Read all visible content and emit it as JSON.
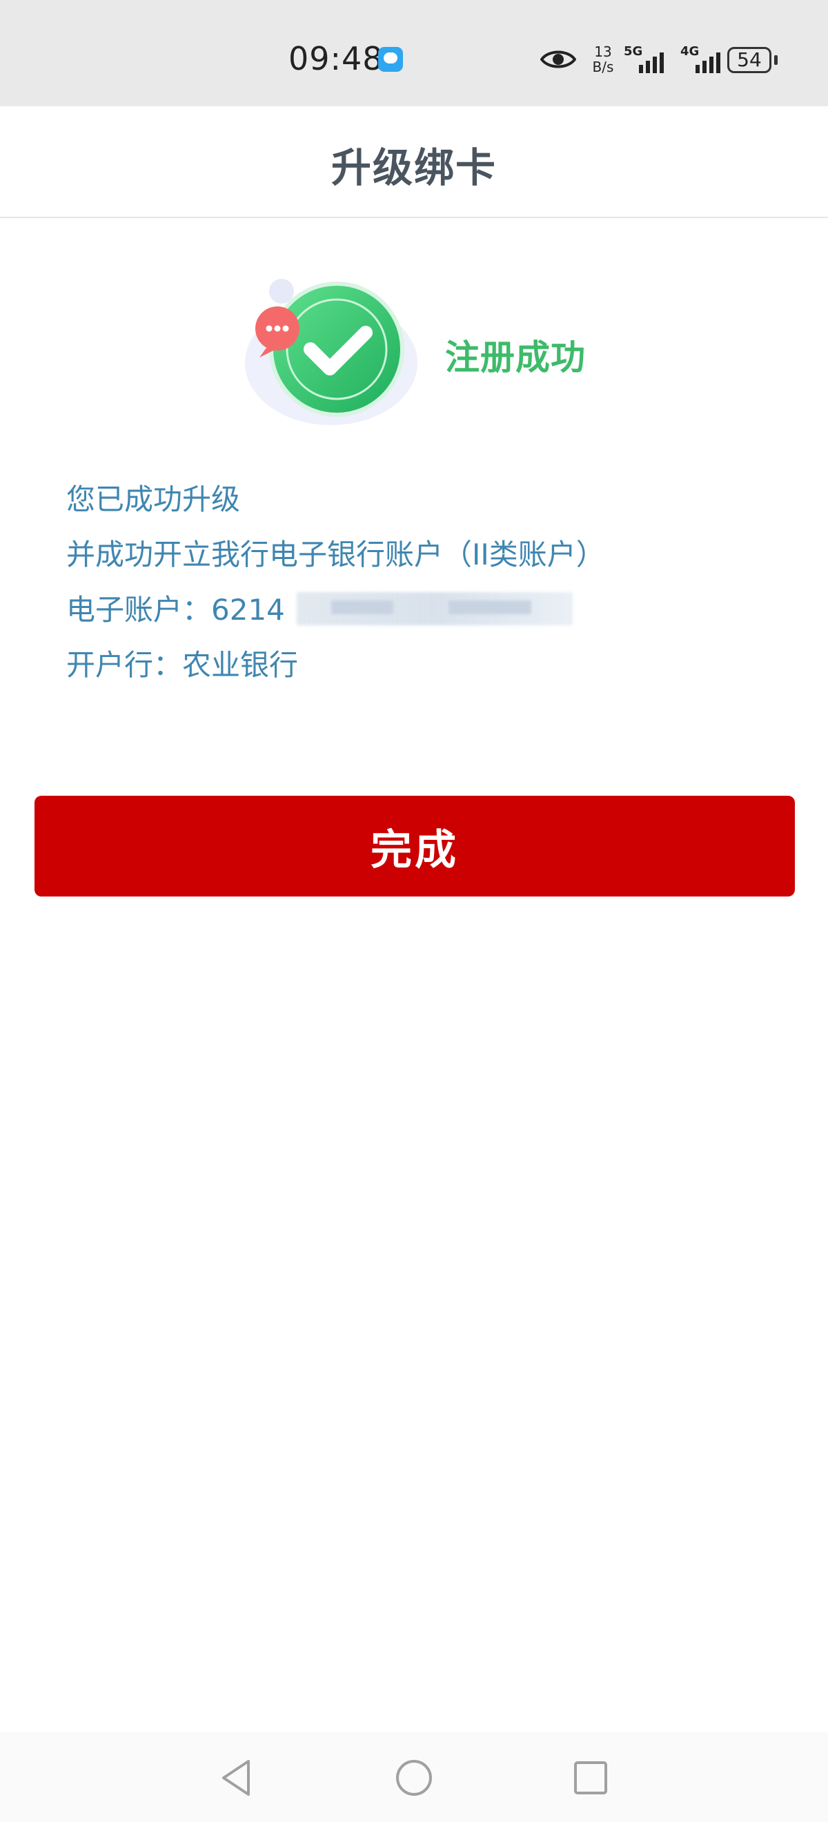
{
  "status_bar": {
    "time": "09:48",
    "network_speed_value": "13",
    "network_speed_unit": "B/s",
    "signal1_label": "5G",
    "signal2_label": "4G",
    "battery_level": "54"
  },
  "header": {
    "title": "升级绑卡"
  },
  "success": {
    "message": "注册成功"
  },
  "info": {
    "line1": "您已成功升级",
    "line2": "并成功开立我行电子银行账户（II类账户）",
    "account_label": "电子账户：",
    "account_visible": "6214",
    "bank_label": "开户行：",
    "bank_name": "农业银行"
  },
  "actions": {
    "done_label": "完成"
  },
  "colors": {
    "accent_red": "#cc0000",
    "success_green": "#3dbb6a",
    "info_blue": "#3f86b0"
  }
}
